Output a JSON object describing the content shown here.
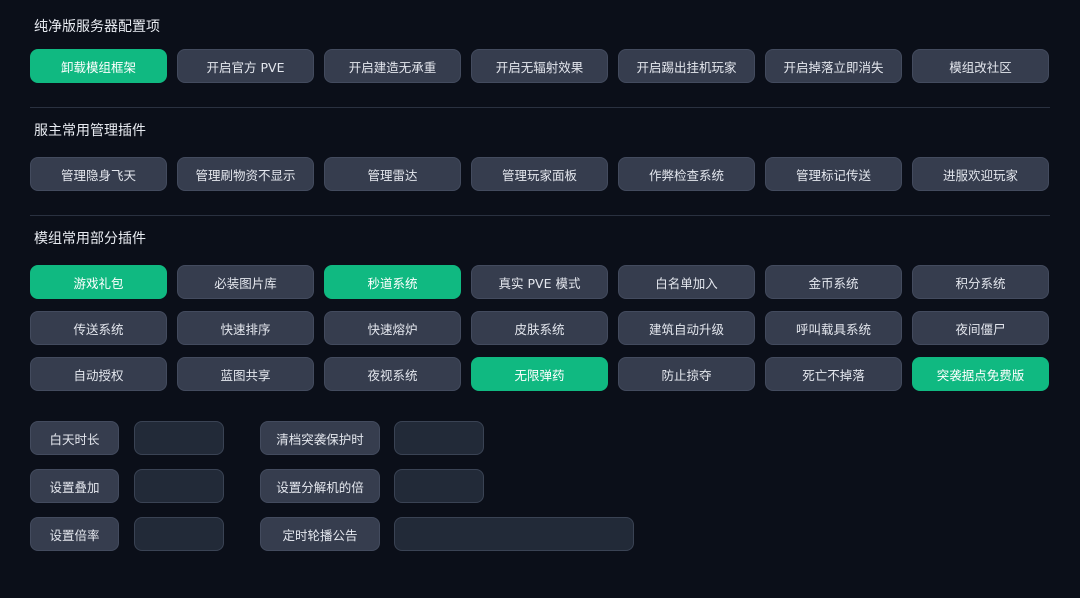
{
  "sections": [
    {
      "title": "纯净版服务器配置项",
      "buttons": [
        {
          "label": "卸载模组框架",
          "active": true
        },
        {
          "label": "开启官方 PVE",
          "active": false
        },
        {
          "label": "开启建造无承重",
          "active": false
        },
        {
          "label": "开启无辐射效果",
          "active": false
        },
        {
          "label": "开启踢出挂机玩家",
          "active": false
        },
        {
          "label": "开启掉落立即消失",
          "active": false
        },
        {
          "label": "模组改社区",
          "active": false
        }
      ]
    },
    {
      "title": "服主常用管理插件",
      "buttons": [
        {
          "label": "管理隐身飞天",
          "active": false
        },
        {
          "label": "管理刷物资不显示",
          "active": false
        },
        {
          "label": "管理雷达",
          "active": false
        },
        {
          "label": "管理玩家面板",
          "active": false
        },
        {
          "label": "作弊检查系统",
          "active": false
        },
        {
          "label": "管理标记传送",
          "active": false
        },
        {
          "label": "进服欢迎玩家",
          "active": false
        }
      ]
    },
    {
      "title": "模组常用部分插件",
      "buttons": [
        {
          "label": "游戏礼包",
          "active": true
        },
        {
          "label": "必装图片库",
          "active": false
        },
        {
          "label": "秒道系统",
          "active": true
        },
        {
          "label": "真实 PVE 模式",
          "active": false
        },
        {
          "label": "白名单加入",
          "active": false
        },
        {
          "label": "金币系统",
          "active": false
        },
        {
          "label": "积分系统",
          "active": false
        },
        {
          "label": "传送系统",
          "active": false
        },
        {
          "label": "快速排序",
          "active": false
        },
        {
          "label": "快速熔炉",
          "active": false
        },
        {
          "label": "皮肤系统",
          "active": false
        },
        {
          "label": "建筑自动升级",
          "active": false
        },
        {
          "label": "呼叫载具系统",
          "active": false
        },
        {
          "label": "夜间僵尸",
          "active": false
        },
        {
          "label": "自动授权",
          "active": false
        },
        {
          "label": "蓝图共享",
          "active": false
        },
        {
          "label": "夜视系统",
          "active": false
        },
        {
          "label": "无限弹药",
          "active": true
        },
        {
          "label": "防止掠夺",
          "active": false
        },
        {
          "label": "死亡不掉落",
          "active": false
        },
        {
          "label": "突袭据点免费版",
          "active": true
        }
      ]
    }
  ],
  "settings": {
    "daytime": {
      "label": "白天时长",
      "value": ""
    },
    "stack": {
      "label": "设置叠加",
      "value": ""
    },
    "rate": {
      "label": "设置倍率",
      "value": ""
    },
    "wipe_protect": {
      "label": "清档突袭保护时",
      "value": ""
    },
    "recycler_rate": {
      "label": "设置分解机的倍",
      "value": ""
    },
    "broadcast": {
      "label": "定时轮播公告",
      "value": ""
    }
  },
  "colors": {
    "active": "#10b981",
    "button": "#363d4e",
    "input": "#222a38",
    "background": "#0b0f19"
  }
}
